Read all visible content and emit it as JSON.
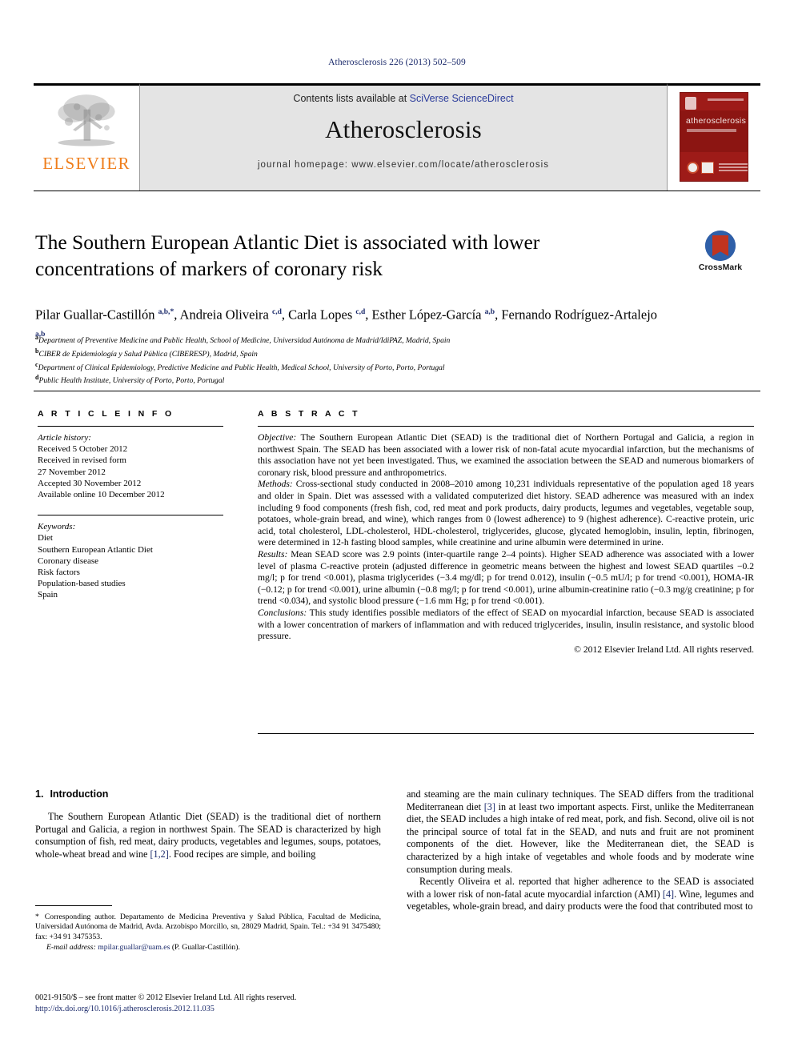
{
  "running_head": "Atherosclerosis 226 (2013) 502–509",
  "masthead": {
    "publisher_name": "ELSEVIER",
    "contents_prefix": "Contents lists available at ",
    "contents_link": "SciVerse ScienceDirect",
    "journal_title": "Atherosclerosis",
    "homepage": "journal homepage: www.elsevier.com/locate/atherosclerosis",
    "cover_title": "atherosclerosis"
  },
  "article": {
    "title": "The Southern European Atlantic Diet is associated with lower concentrations of markers of coronary risk",
    "crossmark_label": "CrossMark",
    "authors_html": "Pilar Guallar-Castillón <sup>a,b,</sup><sup>*</sup>, Andreia Oliveira <sup>c,d</sup>, Carla Lopes <sup>c,d</sup>, Esther López-García <sup>a,b</sup>, Fernando Rodríguez-Artalejo <sup>a,b</sup>",
    "affiliations": [
      {
        "mark": "a",
        "text": "Department of Preventive Medicine and Public Health, School of Medicine, Universidad Autónoma de Madrid/IdiPAZ, Madrid, Spain"
      },
      {
        "mark": "b",
        "text": "CIBER de Epidemiología y Salud Pública (CIBERESP), Madrid, Spain"
      },
      {
        "mark": "c",
        "text": "Department of Clinical Epidemiology, Predictive Medicine and Public Health, Medical School, University of Porto, Porto, Portugal"
      },
      {
        "mark": "d",
        "text": "Public Health Institute, University of Porto, Porto, Portugal"
      }
    ]
  },
  "article_info": {
    "heading": "A R T I C L E   I N F O",
    "history_label": "Article history:",
    "history": [
      "Received 5 October 2012",
      "Received in revised form",
      "27 November 2012",
      "Accepted 30 November 2012",
      "Available online 10 December 2012"
    ],
    "keywords_label": "Keywords:",
    "keywords": [
      "Diet",
      "Southern European Atlantic Diet",
      "Coronary disease",
      "Risk factors",
      "Population-based studies",
      "Spain"
    ]
  },
  "abstract": {
    "heading": "A B S T R A C T",
    "objective_label": "Objective:",
    "objective_text": " The Southern European Atlantic Diet (SEAD) is the traditional diet of Northern Portugal and Galicia, a region in northwest Spain. The SEAD has been associated with a lower risk of non-fatal acute myocardial infarction, but the mechanisms of this association have not yet been investigated. Thus, we examined the association between the SEAD and numerous biomarkers of coronary risk, blood pressure and anthropometrics.",
    "methods_label": "Methods:",
    "methods_text": " Cross-sectional study conducted in 2008–2010 among 10,231 individuals representative of the population aged 18 years and older in Spain. Diet was assessed with a validated computerized diet history. SEAD adherence was measured with an index including 9 food components (fresh fish, cod, red meat and pork products, dairy products, legumes and vegetables, vegetable soup, potatoes, whole-grain bread, and wine), which ranges from 0 (lowest adherence) to 9 (highest adherence). C-reactive protein, uric acid, total cholesterol, LDL-cholesterol, HDL-cholesterol, triglycerides, glucose, glycated hemoglobin, insulin, leptin, fibrinogen, were determined in 12-h fasting blood samples, while creatinine and urine albumin were determined in urine.",
    "results_label": "Results:",
    "results_text": " Mean SEAD score was 2.9 points (inter-quartile range 2–4 points). Higher SEAD adherence was associated with a lower level of plasma C-reactive protein (adjusted difference in geometric means between the highest and lowest SEAD quartiles −0.2 mg/l; p for trend <0.001), plasma triglycerides (−3.4 mg/dl; p for trend 0.012), insulin (−0.5 mU/l; p for trend <0.001), HOMA-IR (−0.12; p for trend <0.001), urine albumin (−0.8 mg/l; p for trend <0.001), urine albumin-creatinine ratio (−0.3 mg/g creatinine; p for trend <0.034), and systolic blood pressure (−1.6 mm Hg; p for trend <0.001).",
    "conclusions_label": "Conclusions:",
    "conclusions_text": " This study identifies possible mediators of the effect of SEAD on myocardial infarction, because SEAD is associated with a lower concentration of markers of inflammation and with reduced triglycerides, insulin, insulin resistance, and systolic blood pressure.",
    "copyright": "© 2012 Elsevier Ireland Ltd. All rights reserved."
  },
  "introduction": {
    "number": "1.",
    "heading": "Introduction",
    "para1_a": "The Southern European Atlantic Diet (SEAD) is the traditional diet of northern Portugal and Galicia, a region in northwest Spain. The SEAD is characterized by high consumption of fish, red meat, dairy products, vegetables and legumes, soups, potatoes, whole-wheat bread and wine ",
    "para1_ref1": "[1,2]",
    "para1_b": ". Food recipes are simple, and boiling and steaming are the main culinary techniques. The SEAD differs from the traditional Mediterranean diet ",
    "para1_ref2": "[3]",
    "para1_c": " in at least two important aspects. First, unlike the Mediterranean diet, the SEAD includes a high intake of red meat, pork, and fish. Second, olive oil is not the principal source of total fat in the SEAD, and nuts and fruit are not prominent components of the diet. However, like the Mediterranean diet, the SEAD is characterized by a high intake of vegetables and whole foods and by moderate wine consumption during meals.",
    "para2_a": "Recently Oliveira et al. reported that higher adherence to the SEAD is associated with a lower risk of non-fatal acute myocardial infarction (AMI) ",
    "para2_ref": "[4]",
    "para2_b": ". Wine, legumes and vegetables, whole-grain bread, and dairy products were the food that contributed most to"
  },
  "footnotes": {
    "corresponding_star": "*",
    "corresponding_text": " Corresponding author. Departamento de Medicina Preventiva y Salud Pública, Facultad de Medicina, Universidad Autónoma de Madrid, Avda. Arzobispo Morcillo, sn, 28029 Madrid, Spain. Tel.: +34 91 3475480; fax: +34 91 3475353.",
    "email_label": "E-mail address:",
    "email": "mpilar.guallar@uam.es",
    "email_suffix": " (P. Guallar-Castillón).",
    "issn_line": "0021-9150/$ – see front matter © 2012 Elsevier Ireland Ltd. All rights reserved.",
    "doi": "http://dx.doi.org/10.1016/j.atherosclerosis.2012.11.035"
  }
}
